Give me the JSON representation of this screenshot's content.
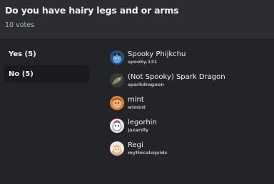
{
  "poll": {
    "question": "Do you have hairy legs and or arms",
    "votes_label": "10 votes"
  },
  "options": [
    {
      "label": "Yes (5)",
      "selected": false
    },
    {
      "label": "No (5)",
      "selected": true
    }
  ],
  "voters": [
    {
      "display_name": "Spooky Phijkchu",
      "username": "spooky.131",
      "avatar_icon": "blue-character-avatar"
    },
    {
      "display_name": "(Not Spooky) Spark Dragon",
      "username": "sparkdragoon",
      "avatar_icon": "dragon-avatar"
    },
    {
      "display_name": "mint",
      "username": "wimint",
      "avatar_icon": "orange-character-avatar"
    },
    {
      "display_name": "legorhin",
      "username": "jazardly",
      "avatar_icon": "character-avatar"
    },
    {
      "display_name": "Regi",
      "username": "mythicalsquids",
      "avatar_icon": "girl-avatar"
    }
  ],
  "colors": {
    "background": "#2b2d31",
    "panel": "#232428",
    "selected_option": "#1a1b1e",
    "text_primary": "#f2f3f5",
    "text_muted": "#b5bac1"
  }
}
